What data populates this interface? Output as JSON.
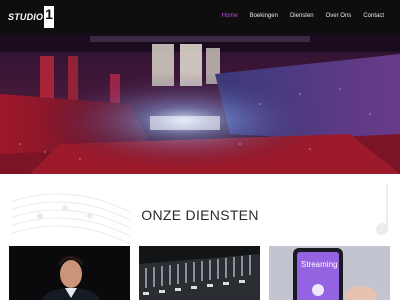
{
  "brand": {
    "logo_text": "STUDIO",
    "logo_number": "1"
  },
  "nav": {
    "items": [
      {
        "label": "Home",
        "active": true
      },
      {
        "label": "Boekingen",
        "active": false
      },
      {
        "label": "Diensten",
        "active": false
      },
      {
        "label": "Over Ons",
        "active": false
      },
      {
        "label": "Contact",
        "active": false
      }
    ]
  },
  "hero": {
    "image": "concert-arena-photo"
  },
  "services": {
    "title": "ONZE DIENSTEN",
    "cards": [
      {
        "image": "presenter-photo"
      },
      {
        "image": "mixing-console-photo"
      },
      {
        "image": "streaming-phone-photo",
        "overlay_text": "Streaming"
      }
    ]
  },
  "colors": {
    "header_bg": "#0e0e0e",
    "nav_active": "#b64cd6",
    "nav_text": "#e8e8e8"
  }
}
